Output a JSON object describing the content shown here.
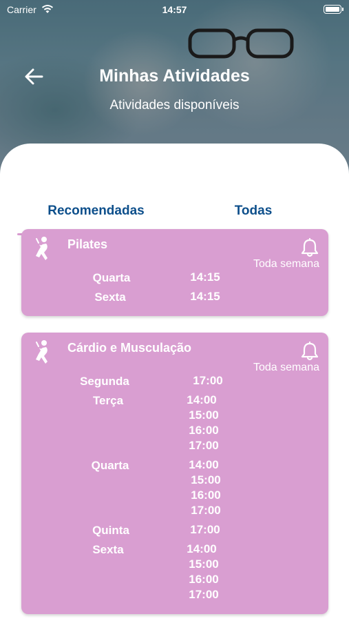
{
  "status_bar": {
    "carrier": "Carrier",
    "time": "14:57"
  },
  "header": {
    "title": "Minhas Atividades",
    "subtitle": "Atividades disponíveis"
  },
  "tabs": [
    {
      "label": "Recomendadas",
      "active": true
    },
    {
      "label": "Todas",
      "active": false
    }
  ],
  "activities": [
    {
      "name": "Pilates",
      "frequency": "Toda semana",
      "schedule": [
        {
          "day": "Quarta",
          "times": [
            "14:15"
          ]
        },
        {
          "day": "Sexta",
          "times": [
            "14:15"
          ]
        }
      ]
    },
    {
      "name": "Cárdio e Musculação",
      "frequency": "Toda semana",
      "schedule": [
        {
          "day": "Segunda",
          "times": [
            "17:00"
          ]
        },
        {
          "day": "Terça",
          "times": [
            "14:00",
            "15:00",
            "16:00",
            "17:00"
          ]
        },
        {
          "day": "Quarta",
          "times": [
            "14:00",
            "15:00",
            "16:00",
            "17:00"
          ]
        },
        {
          "day": "Quinta",
          "times": [
            "17:00"
          ]
        },
        {
          "day": "Sexta",
          "times": [
            "14:00",
            "15:00",
            "16:00",
            "17:00"
          ]
        }
      ]
    }
  ],
  "colors": {
    "accent": "#0d4f8b",
    "card": "#d99ed1",
    "tab_underline": "#d99bd0"
  },
  "icons": {
    "back": "arrow-left-icon",
    "activity": "runner-icon",
    "reminder": "bell-icon",
    "wifi": "wifi-icon",
    "battery": "battery-icon"
  }
}
